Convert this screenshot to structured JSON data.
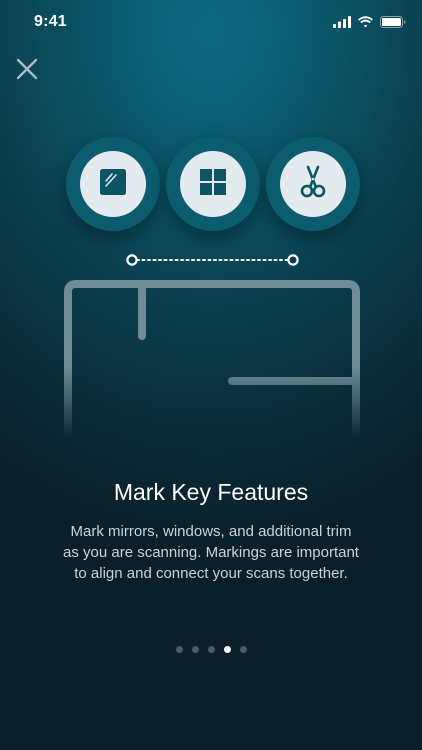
{
  "status_bar": {
    "time": "9:41",
    "icons": [
      "cellular-signal-icon",
      "wifi-icon",
      "battery-icon"
    ]
  },
  "close_button": {
    "icon": "close-icon"
  },
  "features": [
    {
      "name": "mirror",
      "icon": "mirror-icon"
    },
    {
      "name": "window",
      "icon": "window-icon"
    },
    {
      "name": "trim",
      "icon": "scissors-icon"
    }
  ],
  "content": {
    "title": "Mark Key Features",
    "description": "Mark mirrors, windows, and additional trim as you are scanning. Markings are important to align and connect your scans together."
  },
  "pager": {
    "total": 5,
    "current_index": 3
  },
  "colors": {
    "background_top": "#0c6a80",
    "background_bottom": "#0a1f2a",
    "circle_ring": "#0b5c6f",
    "circle_fill": "#e4ebee",
    "icon_color": "#0b5566",
    "outline": "#6f8d97"
  }
}
